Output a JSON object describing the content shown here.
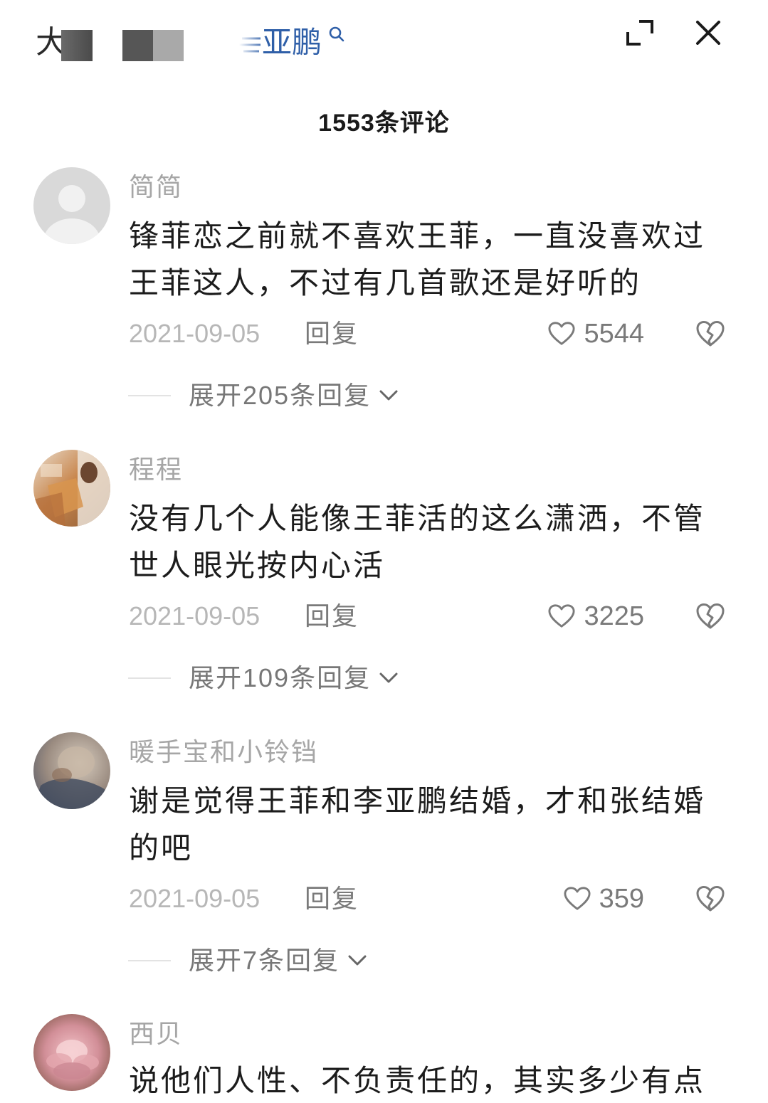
{
  "header": {
    "prefix": "大",
    "search_query": "亚鹏",
    "search_icon": "search-icon",
    "expand_icon": "expand-icon",
    "close_icon": "close-icon"
  },
  "title": "1553条评论",
  "icons": {
    "like": "heart-icon",
    "dislike": "broken-heart-icon",
    "expand_replies": "chevron-down-icon",
    "default_avatar": "user-avatar-icon"
  },
  "colors": {
    "search_text": "#2f5fa8",
    "username": "#a6a6a6",
    "comment_text": "#1c1c1c",
    "meta_text": "#7a7a7a"
  },
  "comments": [
    {
      "username": "简简",
      "text_lines": [
        "锋菲恋之前就不喜欢王菲，一直没喜欢过",
        "王菲这人，不过有几首歌还是好听的"
      ],
      "date": "2021-09-05",
      "reply_label": "回复",
      "likes": "5544",
      "expand_label": "展开205条回复"
    },
    {
      "username": "程程",
      "text_lines": [
        "没有几个人能像王菲活的这么潇洒，不管",
        "世人眼光按内心活"
      ],
      "date": "2021-09-05",
      "reply_label": "回复",
      "likes": "3225",
      "expand_label": "展开109条回复"
    },
    {
      "username": "暖手宝和小铃铛",
      "text_lines": [
        "谢是觉得王菲和李亚鹏结婚，才和张结婚",
        "的吧"
      ],
      "date": "2021-09-05",
      "reply_label": "回复",
      "likes": "359",
      "expand_label": "展开7条回复"
    },
    {
      "username": "西贝",
      "text_lines": [
        "说他们人性、不负责任的，其实多少有点"
      ]
    }
  ]
}
